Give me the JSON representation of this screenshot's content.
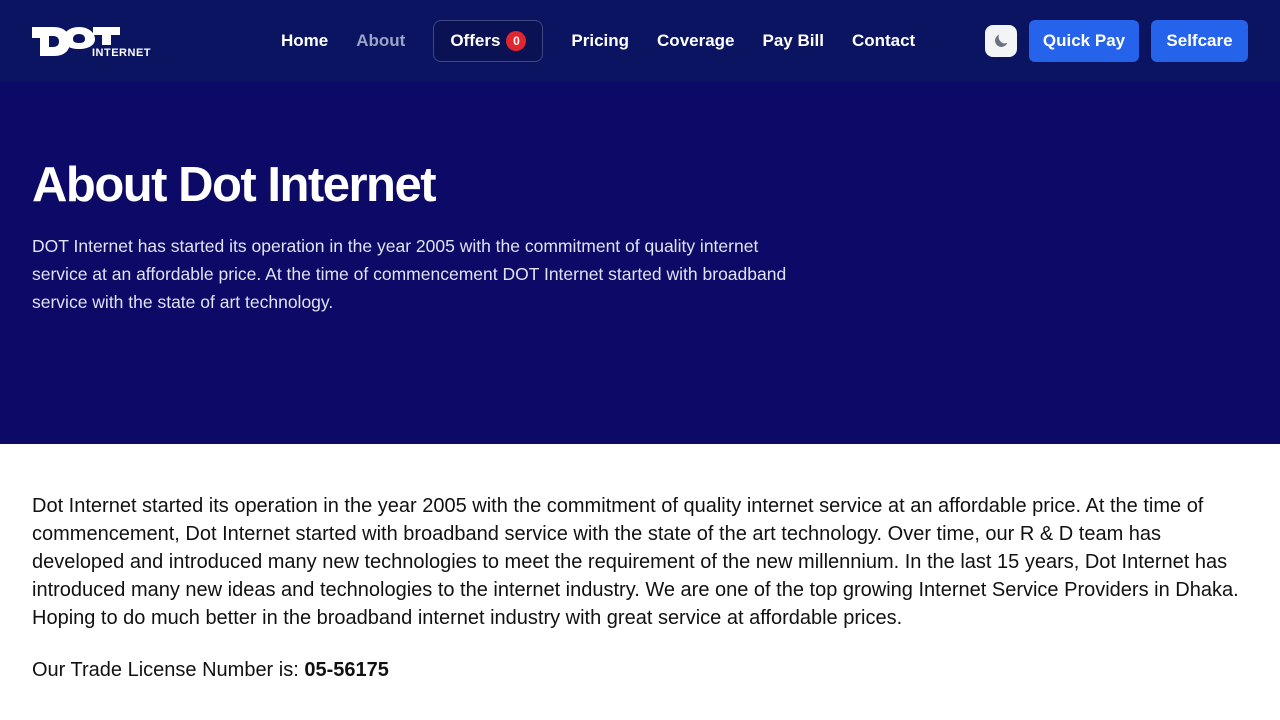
{
  "brand": {
    "logo_text_main": "DOT",
    "logo_text_sub": "INTERNET"
  },
  "nav": {
    "items": [
      {
        "label": "Home"
      },
      {
        "label": "About"
      },
      {
        "label": "Offers",
        "badge": "0"
      },
      {
        "label": "Pricing"
      },
      {
        "label": "Coverage"
      },
      {
        "label": "Pay Bill"
      },
      {
        "label": "Contact"
      }
    ],
    "theme_toggle_icon": "moon-icon",
    "quick_pay_label": "Quick Pay",
    "selfcare_label": "Selfcare"
  },
  "hero": {
    "title": "About Dot Internet",
    "description": "DOT Internet has started its operation in the year 2005 with the commitment of quality internet service at an affordable price. At the time of commencement DOT Internet started with broadband service with the state of art technology."
  },
  "content": {
    "paragraph": "Dot Internet started its operation in the year 2005 with the commitment of quality internet service at an affordable price. At the time of commencement, Dot Internet started with broadband service with the state of the art technology. Over time, our R & D team has developed and introduced many new technologies to meet the requirement of the new millennium. In the last 15 years, Dot Internet has introduced many new ideas and technologies to the internet industry. We are one of the top growing Internet Service Providers in Dhaka. Hoping to do much better in the broadband internet industry with great service at affordable prices.",
    "license_label": "Our Trade License Number is: ",
    "license_number": "05-56175"
  },
  "colors": {
    "nav_bg": "#0b1460",
    "hero_bg": "#0d0966",
    "accent": "#2563eb",
    "badge": "#e0262e"
  }
}
